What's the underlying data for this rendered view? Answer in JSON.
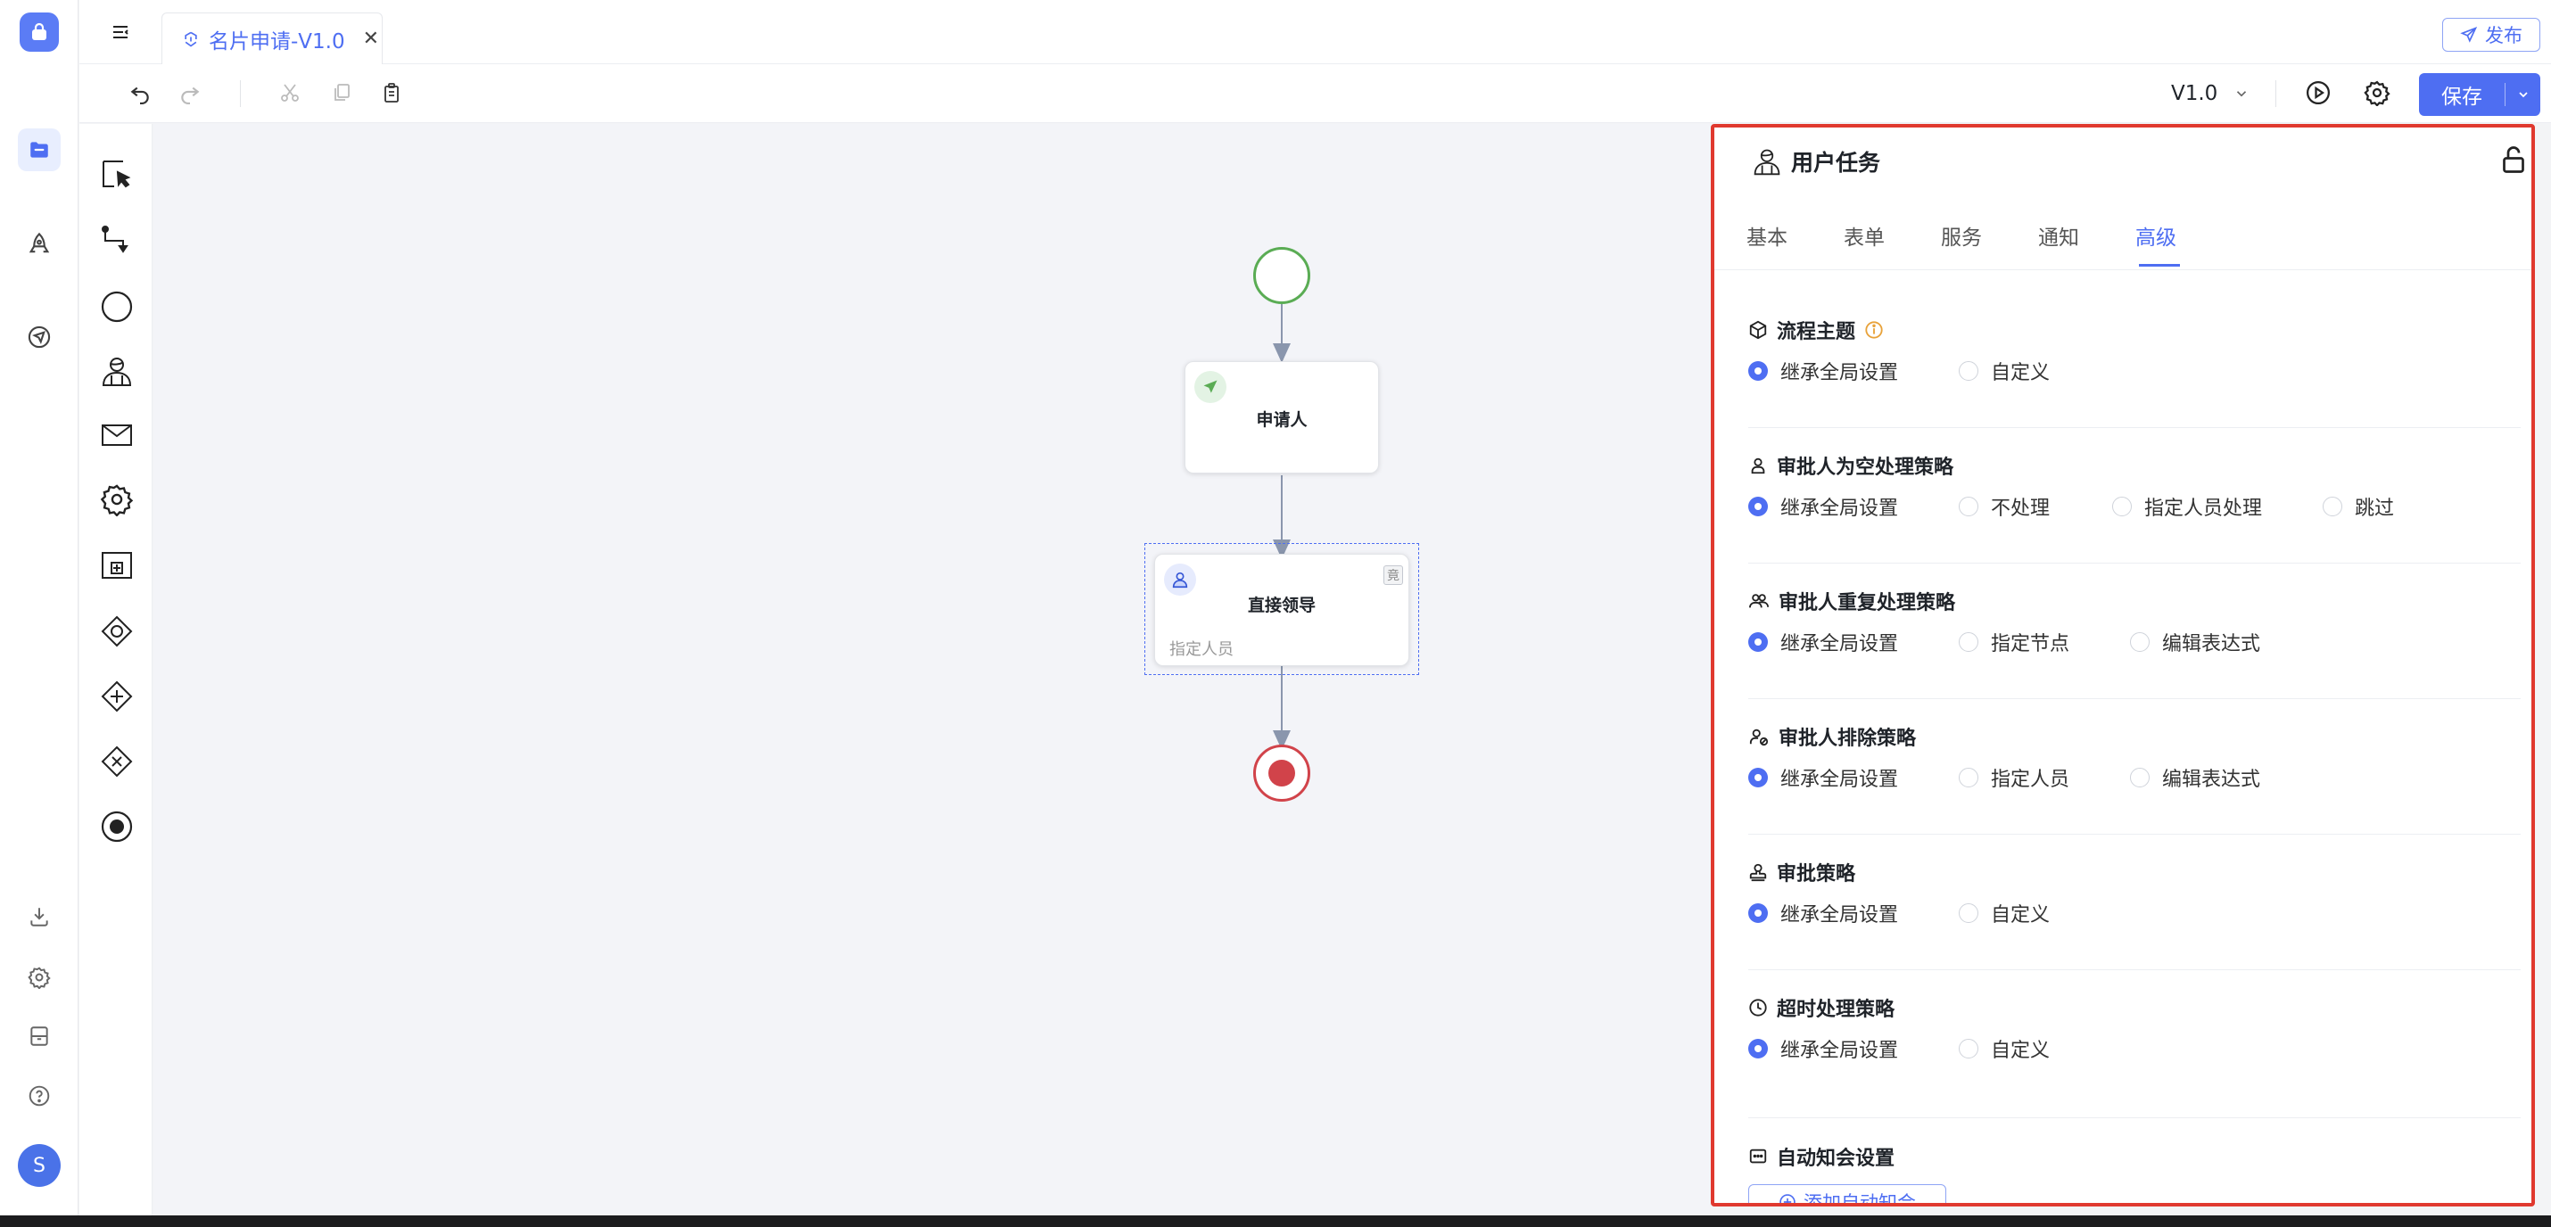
{
  "tab": {
    "title": "名片申请-V1.0"
  },
  "header": {
    "publish_label": "发布"
  },
  "toolbar": {
    "version": "V1.0",
    "save_label": "保存"
  },
  "rail": {
    "avatar_initial": "S"
  },
  "palette": {
    "items": [
      "select-tool",
      "connect-tool",
      "start-event",
      "user-task",
      "message-task",
      "service-task",
      "subprocess",
      "gateway",
      "parallel-gateway",
      "exclusive-gateway",
      "end-event"
    ]
  },
  "canvas": {
    "nodes": [
      {
        "id": "applicant",
        "title": "申请人"
      },
      {
        "id": "direct-leader",
        "title": "直接领导",
        "subtitle": "指定人员",
        "badge": "竟"
      }
    ]
  },
  "panel": {
    "title": "用户任务",
    "tabs": [
      "基本",
      "表单",
      "服务",
      "通知",
      "高级"
    ],
    "active_tab": "高级",
    "sections": [
      {
        "title": "流程主题",
        "options": [
          "继承全局设置",
          "自定义"
        ],
        "selected": 0
      },
      {
        "title": "审批人为空处理策略",
        "options": [
          "继承全局设置",
          "不处理",
          "指定人员处理",
          "跳过"
        ],
        "selected": 0
      },
      {
        "title": "审批人重复处理策略",
        "options": [
          "继承全局设置",
          "指定节点",
          "编辑表达式"
        ],
        "selected": 0
      },
      {
        "title": "审批人排除策略",
        "options": [
          "继承全局设置",
          "指定人员",
          "编辑表达式"
        ],
        "selected": 0
      },
      {
        "title": "审批策略",
        "options": [
          "继承全局设置",
          "自定义"
        ],
        "selected": 0
      },
      {
        "title": "超时处理策略",
        "options": [
          "继承全局设置",
          "自定义"
        ],
        "selected": 0
      }
    ],
    "auto_notify": {
      "title": "自动知会设置",
      "add_label": "添加自动知会"
    }
  },
  "colors": {
    "accent": "#4e6ef2",
    "highlight_border": "#e0392f",
    "start": "#5aac54",
    "end": "#d1434a"
  }
}
